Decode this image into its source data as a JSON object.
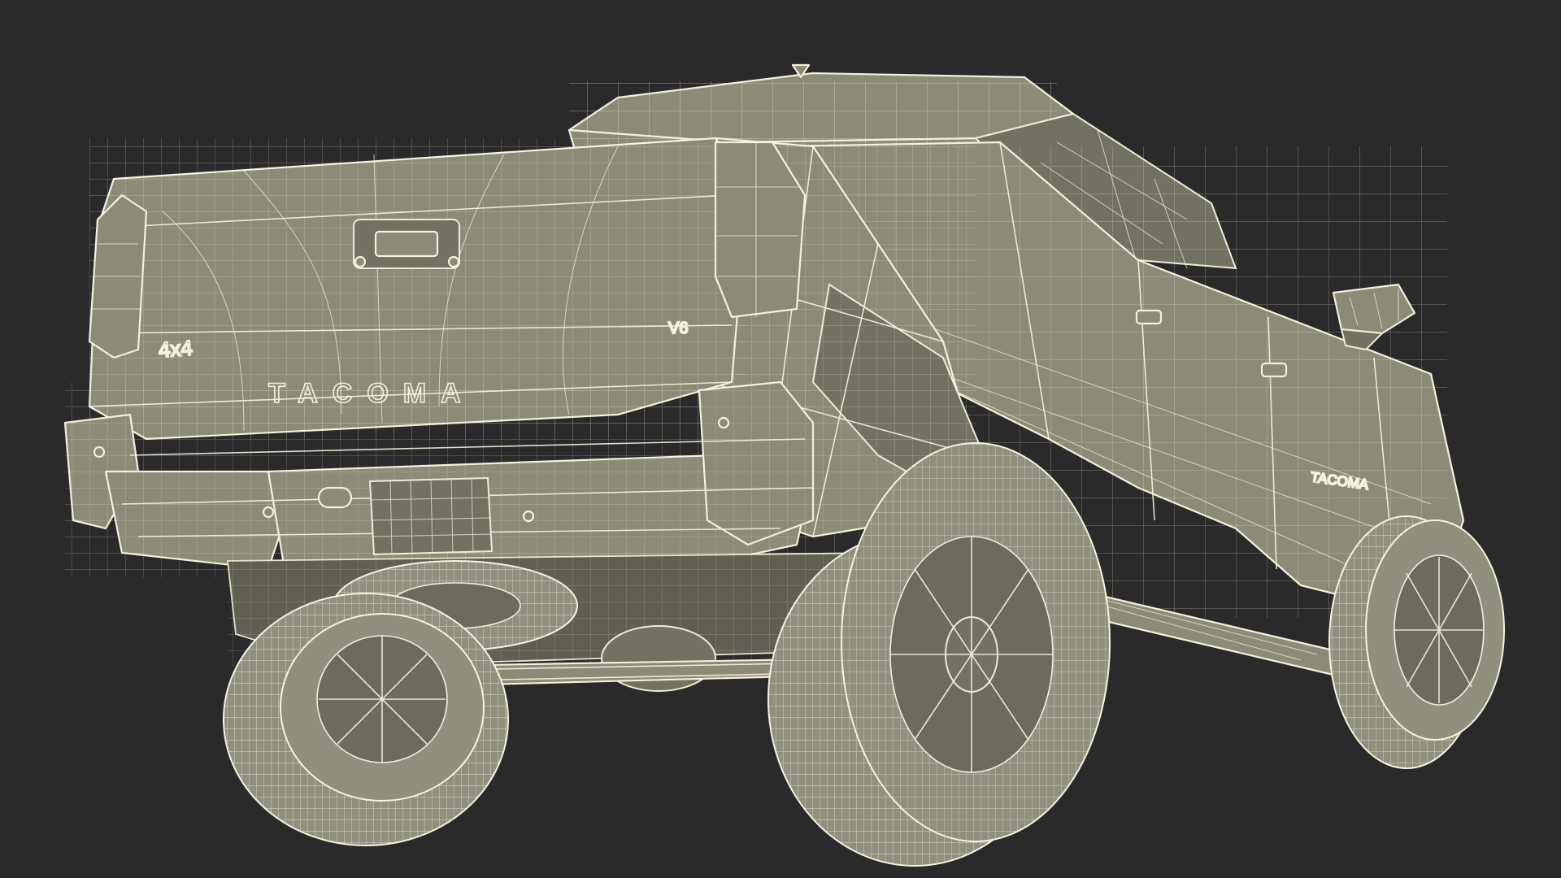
{
  "scene": {
    "background": "#2a2a2a",
    "subject": "wireframe pickup truck, rear three-quarter view",
    "colors": {
      "surface": "#8b8b78",
      "wire": "#f3f0dc",
      "shadow": "#5f5f52"
    }
  },
  "badges": {
    "tailgate_model": "TACOMA",
    "drive": "4x4",
    "engine": "V6",
    "side_model": "TACOMA"
  }
}
